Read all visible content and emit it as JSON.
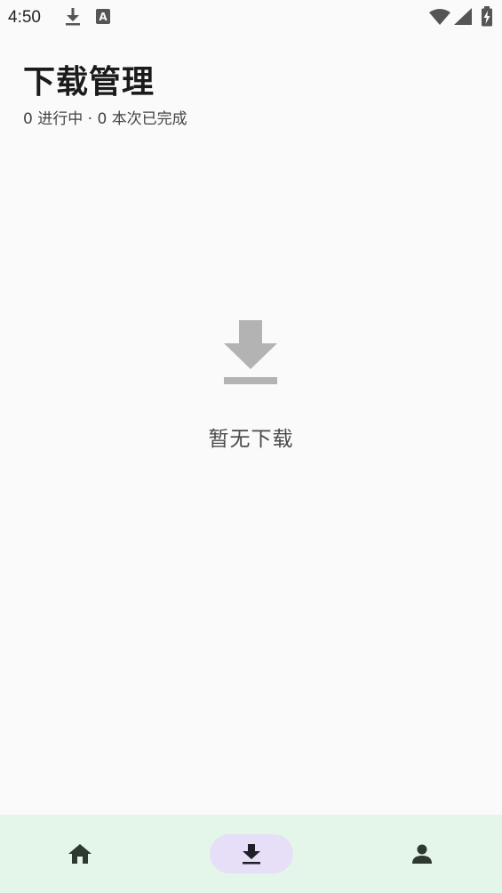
{
  "status_bar": {
    "time": "4:50",
    "icons": [
      "download-icon",
      "font-a-icon",
      "wifi-icon",
      "signal-icon",
      "battery-charging-icon"
    ]
  },
  "header": {
    "title": "下载管理",
    "summary": {
      "in_progress_count": "0",
      "in_progress_label": "进行中",
      "separator": "·",
      "completed_count": "0",
      "completed_label": "本次已完成"
    }
  },
  "empty_state": {
    "icon": "download-icon",
    "text": "暂无下载"
  },
  "bottom_nav": {
    "items": [
      {
        "id": "home",
        "icon": "home-icon",
        "selected": false
      },
      {
        "id": "downloads",
        "icon": "download-icon",
        "selected": true
      },
      {
        "id": "profile",
        "icon": "person-icon",
        "selected": false
      }
    ],
    "selected_pill_color": "#e7def7",
    "background_color": "#e4f6ea"
  }
}
